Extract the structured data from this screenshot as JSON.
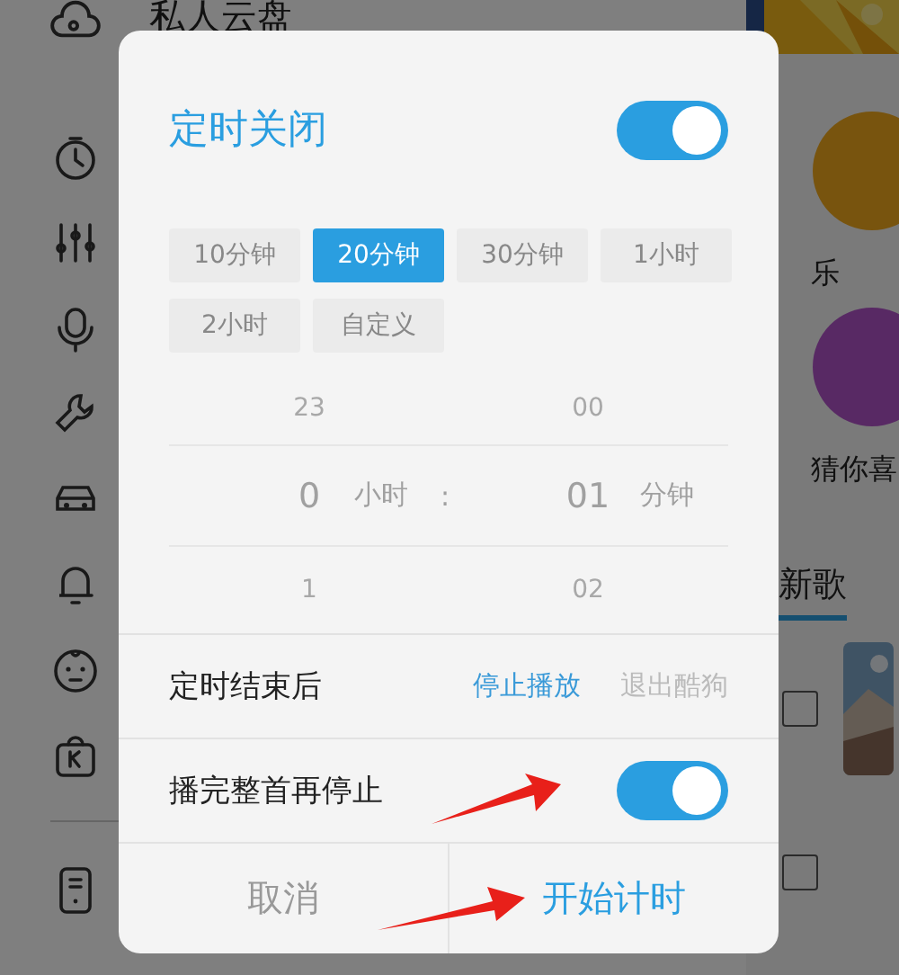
{
  "background": {
    "header": "私人云盘",
    "tiles": [
      "乐",
      "猜你喜"
    ],
    "section": "新歌"
  },
  "dialog": {
    "title": "定时关闭",
    "enabled": true,
    "durations": [
      {
        "label": "10分钟",
        "selected": false
      },
      {
        "label": "20分钟",
        "selected": true
      },
      {
        "label": "30分钟",
        "selected": false
      },
      {
        "label": "1小时",
        "selected": false
      },
      {
        "label": "2小时",
        "selected": false
      },
      {
        "label": "自定义",
        "selected": false
      }
    ],
    "picker": {
      "hours": [
        "23",
        "0",
        "1"
      ],
      "hour_unit": "小时",
      "separator": ":",
      "minutes": [
        "00",
        "01",
        "02"
      ],
      "minute_unit": "分钟"
    },
    "after_end": {
      "label": "定时结束后",
      "options": [
        {
          "label": "停止播放",
          "selected": true
        },
        {
          "label": "退出酷狗",
          "selected": false
        }
      ]
    },
    "finish_song": {
      "label": "播完整首再停止",
      "on": true
    },
    "buttons": [
      {
        "label": "取消",
        "kind": "cancel"
      },
      {
        "label": "开始计时",
        "kind": "confirm"
      }
    ]
  }
}
